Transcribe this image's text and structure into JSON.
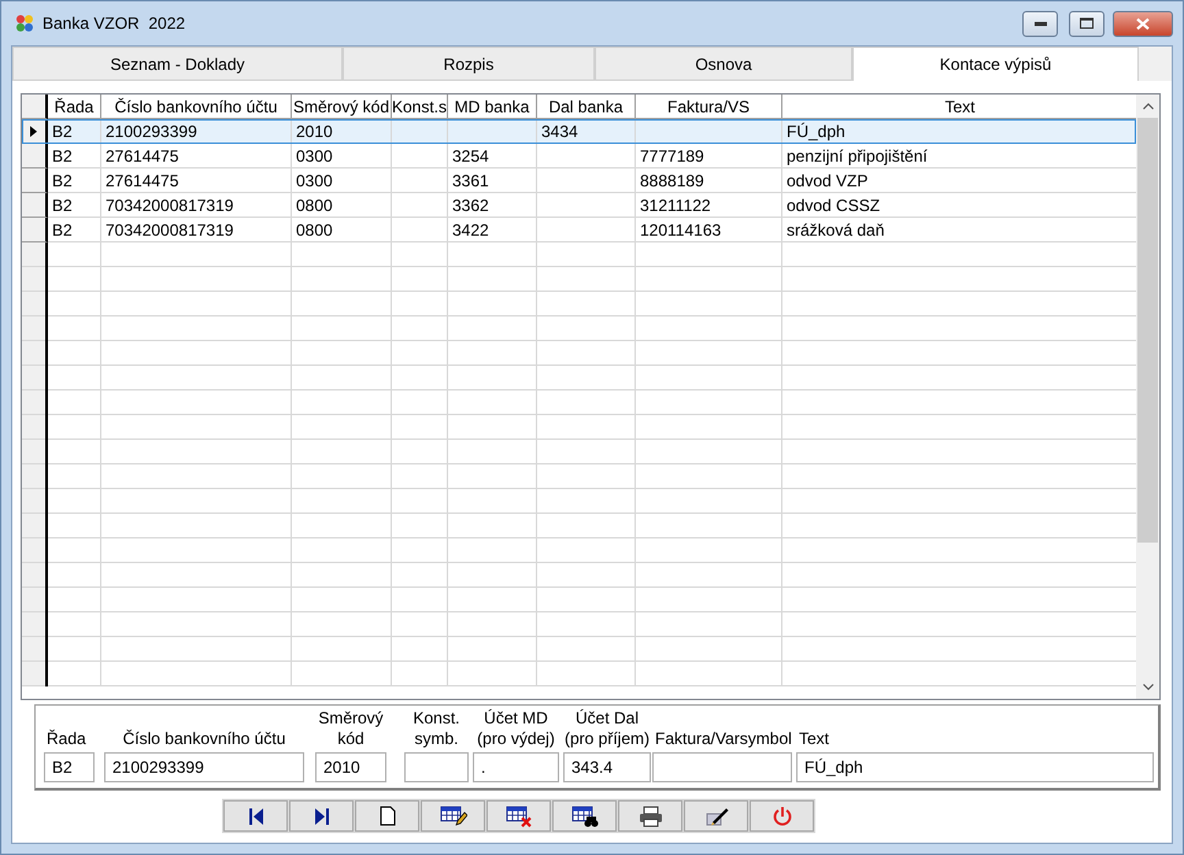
{
  "window": {
    "title": "Banka VZOR  2022"
  },
  "tabs": [
    {
      "label": "Seznam - Doklady",
      "selected": false
    },
    {
      "label": "Rozpis",
      "selected": false
    },
    {
      "label": "Osnova",
      "selected": false
    },
    {
      "label": "Kontace výpisů",
      "selected": true
    }
  ],
  "table": {
    "columns": [
      "Řada",
      "Číslo bankovního účtu",
      "Směrový kód",
      "Konst.s",
      "MD banka",
      "Dal banka",
      "Faktura/VS",
      "Text"
    ],
    "rows": [
      {
        "selected": true,
        "cells": [
          "B2",
          "2100293399",
          "2010",
          "",
          "",
          "3434",
          "",
          "FÚ_dph"
        ]
      },
      {
        "selected": false,
        "cells": [
          "B2",
          "27614475",
          "0300",
          "",
          "3254",
          "",
          "7777189",
          "penzijní připojištění"
        ]
      },
      {
        "selected": false,
        "cells": [
          "B2",
          "27614475",
          "0300",
          "",
          "3361",
          "",
          "8888189",
          "odvod VZP"
        ]
      },
      {
        "selected": false,
        "cells": [
          "B2",
          "70342000817319",
          "0800",
          "",
          "3362",
          "",
          "31211122",
          "odvod CSSZ"
        ]
      },
      {
        "selected": false,
        "cells": [
          "B2",
          "70342000817319",
          "0800",
          "",
          "3422",
          "",
          "120114163",
          "srážková daň"
        ]
      }
    ]
  },
  "form": {
    "fields": [
      {
        "label": "Řada",
        "value": "B2"
      },
      {
        "label": "Číslo bankovního účtu",
        "value": "2100293399"
      },
      {
        "label": "Směrový\nkód",
        "value": "2010"
      },
      {
        "label": "Konst.\nsymb."
      },
      {
        "label": "Účet MD\n(pro výdej)",
        "value": "."
      },
      {
        "label": "Účet Dal\n(pro příjem)",
        "value": "343.4"
      },
      {
        "label": "Faktura/Varsymbol"
      },
      {
        "label": "Text",
        "value": "FÚ_dph"
      }
    ]
  }
}
